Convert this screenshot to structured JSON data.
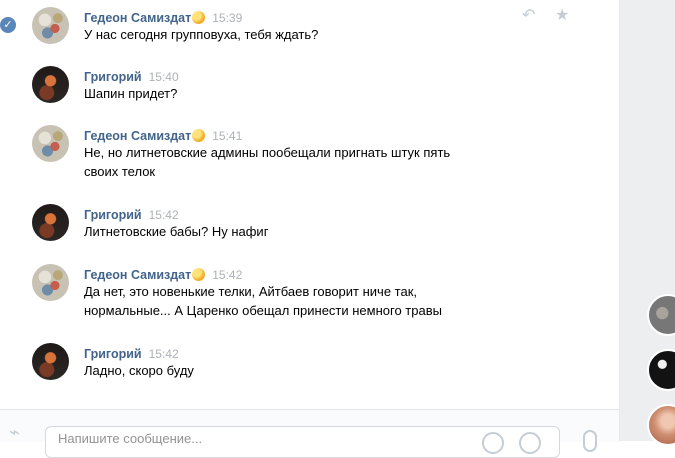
{
  "messages": [
    {
      "sender": "Гедеон Самиздат",
      "time": "15:39",
      "lines": [
        "У нас сегодня групповуха, тебя ждать?"
      ],
      "has_emoji": true,
      "avatar": "gedeon"
    },
    {
      "sender": "Григорий",
      "time": "15:40",
      "lines": [
        "Шапин придет?"
      ],
      "has_emoji": false,
      "avatar": "grigory"
    },
    {
      "sender": "Гедеон Самиздат",
      "time": "15:41",
      "lines": [
        "Не, но литнетовские админы пообещали пригнать штук пять",
        "своих телок"
      ],
      "has_emoji": true,
      "avatar": "gedeon"
    },
    {
      "sender": "Григорий",
      "time": "15:42",
      "lines": [
        "Литнетовские бабы? Ну нафиг"
      ],
      "has_emoji": false,
      "avatar": "grigory"
    },
    {
      "sender": "Гедеон Самиздат",
      "time": "15:42",
      "lines": [
        "Да нет, это новенькие телки, Айтбаев говорит ниче так,",
        "нормальные... А Царенко обещал принести немного травы"
      ],
      "has_emoji": true,
      "avatar": "gedeon"
    },
    {
      "sender": "Григорий",
      "time": "15:42",
      "lines": [
        "Ладно, скоро буду"
      ],
      "has_emoji": false,
      "avatar": "grigory"
    }
  ],
  "composer": {
    "placeholder": "Напишите сообщение..."
  },
  "icons": {
    "read": "check-icon",
    "reply": "reply-icon",
    "favorite": "star-icon",
    "attach": "paperclip-icon",
    "emoji": "emoji-icon",
    "ok": "ok-icon",
    "voice": "microphone-icon"
  }
}
